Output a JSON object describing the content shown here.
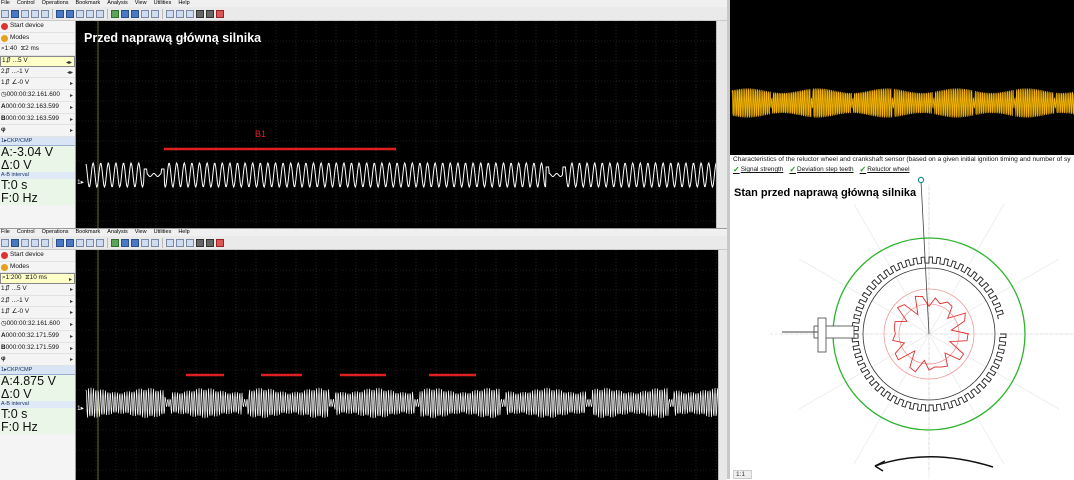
{
  "menu": [
    "File",
    "Control",
    "Operations",
    "Bookmark",
    "Analysis",
    "View",
    "Utilities",
    "Help"
  ],
  "top_pane": {
    "title": "Przed naprawą główną silnika",
    "sidebar": {
      "start_device": "Start device",
      "modes": "Modes",
      "scale": "1:40",
      "time_div": "2 ms",
      "ch1": "1⇵ ...5 V",
      "ch2": "2⇵ ...-1 V",
      "ch1_offset": "1⇵ ∠-0 V",
      "timestamp": "000:00:32.161.600",
      "cursor_a": "000:00:32.163.599",
      "cursor_b": "000:00:32.163.599",
      "phi": "φ",
      "sensor_header": "1▸CKP/CMP",
      "a_value": "A:-3.04 V",
      "delta_value": "Δ:0 V",
      "interval_header": "A-B interval",
      "t_value": "T:0 s",
      "f_value": "F:0 Hz"
    },
    "annotation": "B1",
    "channel_marker": "1▸"
  },
  "bottom_pane": {
    "sidebar": {
      "start_device": "Start device",
      "modes": "Modes",
      "scale": "1:200",
      "time_div": "10 ms",
      "ch1": "1⇵ ...5 V",
      "ch2": "2⇵ ...-1 V",
      "ch1_offset": "1⇵ ∠-0 V",
      "timestamp": "000:00:32.161.600",
      "cursor_a": "000:00:32.171.599",
      "cursor_b": "000:00:32.171.599",
      "phi": "φ",
      "sensor_header": "1▸CKP/CMP",
      "a_value": "A:4.875 V",
      "delta_value": "Δ:0 V",
      "interval_header": "A-B interval",
      "t_value": "T:0 s",
      "f_value": "F:0 Hz"
    },
    "channel_marker": "1▸"
  },
  "right_panel": {
    "caption": "Characteristics of the reluctor wheel and crankshaft sensor (based on a given initial ignition timing and number of sy",
    "checks": [
      "Signal strength",
      "Deviation step teeth",
      "Reluctor wheel"
    ],
    "title": "Stan przed naprawą główną silnika",
    "ratio": "1:1"
  },
  "colors": {
    "signal_white": "#ffffff",
    "signal_amber": "#f5b400",
    "annotation_red": "#e02020",
    "wheel_green": "#2db52d",
    "grid": "#3a3a3a"
  }
}
